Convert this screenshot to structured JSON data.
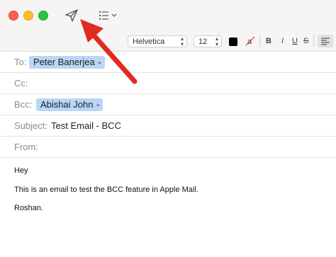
{
  "toolbar": {
    "close_icon": "close-icon",
    "minimize_icon": "minimize-icon",
    "zoom_icon": "zoom-icon",
    "send_icon": "paper-plane-icon",
    "list_icon": "list-icon",
    "chevron": "⌄"
  },
  "format_bar": {
    "font": "Helvetica",
    "size": "12",
    "bold": "B",
    "italic": "I",
    "underline": "U",
    "strike": "S",
    "text_color": "#000000"
  },
  "headers": {
    "to": {
      "label": "To:",
      "recipient": "Peter Banerjea"
    },
    "cc": {
      "label": "Cc:"
    },
    "bcc": {
      "label": "Bcc:",
      "recipient": "Abishai John"
    },
    "subject": {
      "label": "Subject:",
      "value": "Test Email - BCC"
    },
    "from": {
      "label": "From:"
    }
  },
  "message": {
    "greeting": "Hey",
    "line1": "This is an email to test the BCC feature in Apple Mail.",
    "signature": "Roshan."
  },
  "colors": {
    "annotation_arrow": "#e02b20",
    "token_bg": "#b9d6f5"
  }
}
